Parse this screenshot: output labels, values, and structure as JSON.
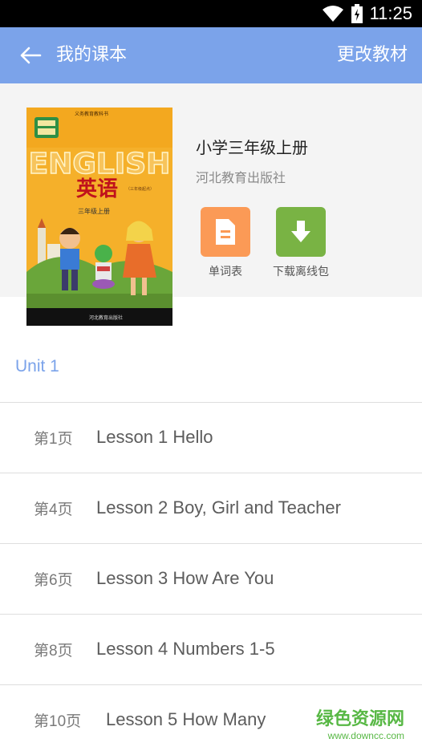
{
  "status": {
    "time": "11:25"
  },
  "header": {
    "title": "我的课本",
    "change_label": "更改教材"
  },
  "book": {
    "title": "小学三年级上册",
    "publisher": "河北教育出版社",
    "cover": {
      "top_text": "义务教育教科书",
      "english": "ENGLISH",
      "chinese": "英语",
      "edition": "（三年级起点）",
      "grade": "三年级上册",
      "press": "河北教育出版社"
    }
  },
  "actions": [
    {
      "label": "单词表",
      "icon": "document-icon",
      "color": "#fb9a56"
    },
    {
      "label": "下载离线包",
      "icon": "download-icon",
      "color": "#79b344"
    }
  ],
  "unit": {
    "title": "Unit 1"
  },
  "lessons": [
    {
      "page": "第1页",
      "name": "Lesson 1 Hello"
    },
    {
      "page": "第4页",
      "name": "Lesson 2 Boy, Girl and Teacher"
    },
    {
      "page": "第6页",
      "name": "Lesson 3 How Are You"
    },
    {
      "page": "第8页",
      "name": "Lesson 4 Numbers 1-5"
    },
    {
      "page": "第10页",
      "name": "Lesson 5 How Many"
    }
  ],
  "watermark": {
    "main": "绿色资源网",
    "sub": "www.downcc.com"
  }
}
